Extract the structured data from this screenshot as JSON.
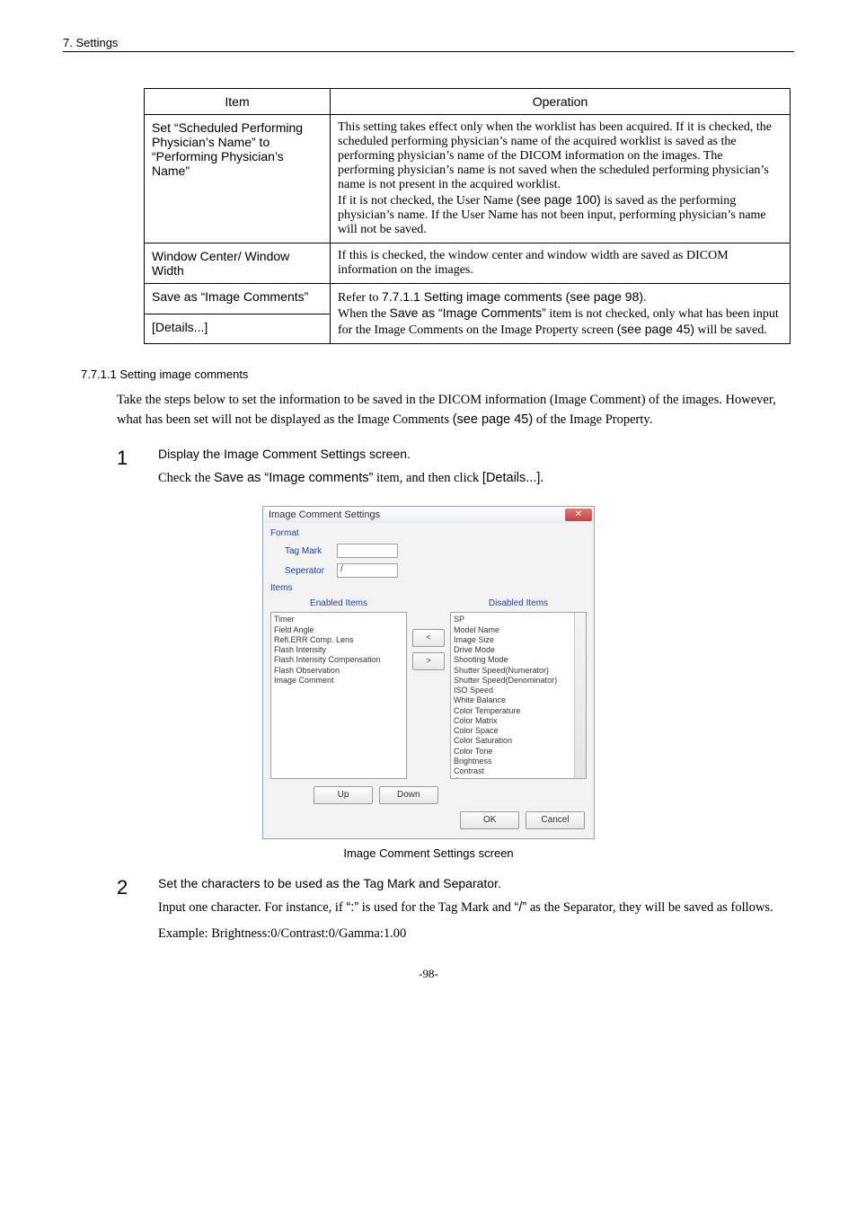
{
  "header": {
    "section": "7. Settings"
  },
  "table": {
    "head": {
      "c1": "Item",
      "c2": "Operation"
    },
    "rows": [
      {
        "c1": "Set “Scheduled Performing Physician’s Name” to “Performing Physician’s Name”",
        "c2_1": "This setting takes effect only when the worklist has been acquired. If it is checked, the scheduled performing physician’s name of the acquired worklist is saved as the performing physician’s name of the DICOM information on the images. The performing physician’s name is not saved when the scheduled performing physician’s name is not present in the acquired worklist.",
        "c2_2a": "If it is not checked, the User Name ",
        "c2_2b": "(see page 100)",
        "c2_2c": " is saved as the performing physician’s name. If the User Name has not been input, performing physician’s name will not be saved."
      },
      {
        "c1": "Window Center/ Window Width",
        "c2": "If this is checked, the window center and window width are saved as DICOM information on the images."
      },
      {
        "c1": "Save as “Image Comments”",
        "c2a": "Refer to ",
        "c2b": "7.7.1.1 Setting image comments (see page 98)",
        "c2c": ".",
        "c2d": "When the ",
        "c2e": "Save as “Image Comments”",
        "c2f": " item is not checked, only what has been input for the Image Comments on the Image Property screen ",
        "c2g": "(see page 45)",
        "c2h": " will be saved."
      },
      {
        "c1": "[Details...]"
      }
    ]
  },
  "sec_head": "7.7.1.1 Setting image comments",
  "para1a": "Take the steps below to set the information to be saved in the DICOM information (Image Comment) of the images. However, what has been set will not be displayed as the Image Comments ",
  "para1b": "(see page 45)",
  "para1c": " of the Image Property.",
  "steps": {
    "s1": {
      "num": "1",
      "lead": "Display the Image Comment Settings screen.",
      "sub_a": "Check the ",
      "sub_b": "Save as “Image comments”",
      "sub_c": " item, and then click ",
      "sub_d": "[Details...]",
      "sub_e": "."
    },
    "s2": {
      "num": "2",
      "lead": "Set the characters to be used as the Tag Mark and Separator.",
      "sub1a": "Input one character. For instance, if  ",
      "q1": "“:”",
      "sub1b": " is used for the Tag Mark and ",
      "q2": "“/”",
      "sub1c": " as the Separator, they will be saved as follows.",
      "sub2": "Example: Brightness:0/Contrast:0/Gamma:1.00"
    }
  },
  "dialog": {
    "title": "Image Comment Settings",
    "format": "Format",
    "tagmark": "Tag Mark",
    "sep": "Seperator",
    "sep_val": "/",
    "items": "Items",
    "enabled": "Enabled Items",
    "disabled": "Disabled Items",
    "enabled_list": "Timer\nField Angle\nRefl.ERR Comp. Lens\nFlash Intensity\nFlash Intensity Compensation\nFlash Observation\nImage Comment",
    "disabled_list": "SP\nModel Name\nImage Size\nDrive Mode\nShooting Mode\nShutter Speed(Numerator)\nShutter Speed(Denominator)\nISO Speed\nWhite Balance\nColor Temperature\nColor Matrix\nColor Space\nColor Saturation\nColor Tone\nBrightness\nContrast\nGamma\nR",
    "move_left": "<",
    "move_right": ">",
    "up": "Up",
    "down": "Down",
    "ok": "OK",
    "cancel": "Cancel"
  },
  "caption": "Image Comment Settings screen",
  "footer": "-98-"
}
